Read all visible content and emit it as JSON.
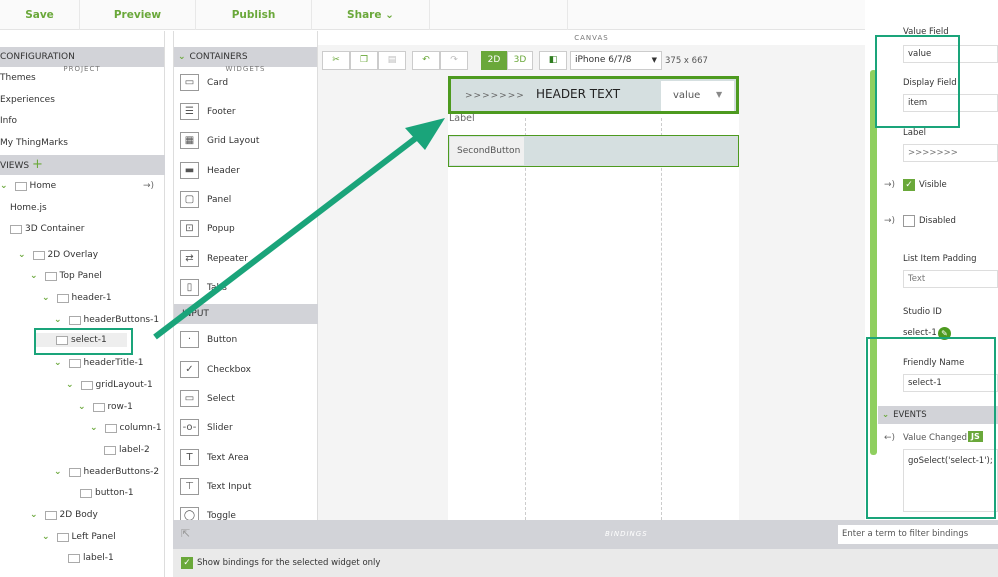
{
  "topbar": {
    "save": "Save",
    "preview": "Preview",
    "publish": "Publish",
    "share": "Share ⌄"
  },
  "project": {
    "title": "PROJECT",
    "configuration": "CONFIGURATION",
    "config_items": [
      "Themes",
      "Experiences",
      "Info",
      "My ThingMarks"
    ],
    "views": "VIEWS",
    "tree": [
      {
        "label": "Home",
        "level": 0
      },
      {
        "label": "Home.js",
        "level": 0
      },
      {
        "label": "3D Container",
        "level": 0
      },
      {
        "label": "2D Overlay",
        "level": 1
      },
      {
        "label": "Top Panel",
        "level": 2
      },
      {
        "label": "header-1",
        "level": 3
      },
      {
        "label": "headerButtons-1",
        "level": 4
      },
      {
        "label": "select-1",
        "level": 5
      },
      {
        "label": "headerTitle-1",
        "level": 4
      },
      {
        "label": "gridLayout-1",
        "level": 5
      },
      {
        "label": "row-1",
        "level": 6
      },
      {
        "label": "column-1",
        "level": 7
      },
      {
        "label": "label-2",
        "level": 7
      },
      {
        "label": "headerButtons-2",
        "level": 4
      },
      {
        "label": "button-1",
        "level": 5
      },
      {
        "label": "2D Body",
        "level": 2
      },
      {
        "label": "Left Panel",
        "level": 3
      },
      {
        "label": "label-1",
        "level": 4
      }
    ]
  },
  "widgets": {
    "title": "WIDGETS",
    "containers": "CONTAINERS",
    "container_items": [
      "Card",
      "Footer",
      "Grid Layout",
      "Header",
      "Panel",
      "Popup",
      "Repeater",
      "Tabs"
    ],
    "input": "INPUT",
    "input_items": [
      "Button",
      "Checkbox",
      "Select",
      "Slider",
      "Text Area",
      "Text Input",
      "Toggle"
    ]
  },
  "canvas": {
    "title": "CANVAS",
    "mode2d": "2D",
    "mode3d": "3D",
    "device": "iPhone 6/7/8",
    "resolution": "375 x 667",
    "header_label": ">>>>>>>",
    "header_text": "HEADER TEXT",
    "select_value": "value",
    "label": "Label",
    "second_button": "SecondButton"
  },
  "props": {
    "value_field_label": "Value Field",
    "value_field": "value",
    "display_field_label": "Display Field",
    "display_field": "item",
    "label_label": "Label",
    "label_value": ">>>>>>>",
    "visible": "Visible",
    "disabled": "Disabled",
    "padding_label": "List Item Padding",
    "padding_placeholder": "Text",
    "studio_id_label": "Studio ID",
    "studio_id": "select-1",
    "friendly_label": "Friendly Name",
    "friendly_name": "select-1",
    "events": "EVENTS",
    "value_changed": "Value Changed",
    "js": "JS",
    "code": "goSelect('select-1');"
  },
  "bindings": {
    "title": "BINDINGS",
    "filter_placeholder": "Enter a term to filter bindings",
    "show_selected": "Show bindings for the selected widget only"
  },
  "colors": {
    "accent": "#6aa83a",
    "highlight": "#1aa47a"
  }
}
